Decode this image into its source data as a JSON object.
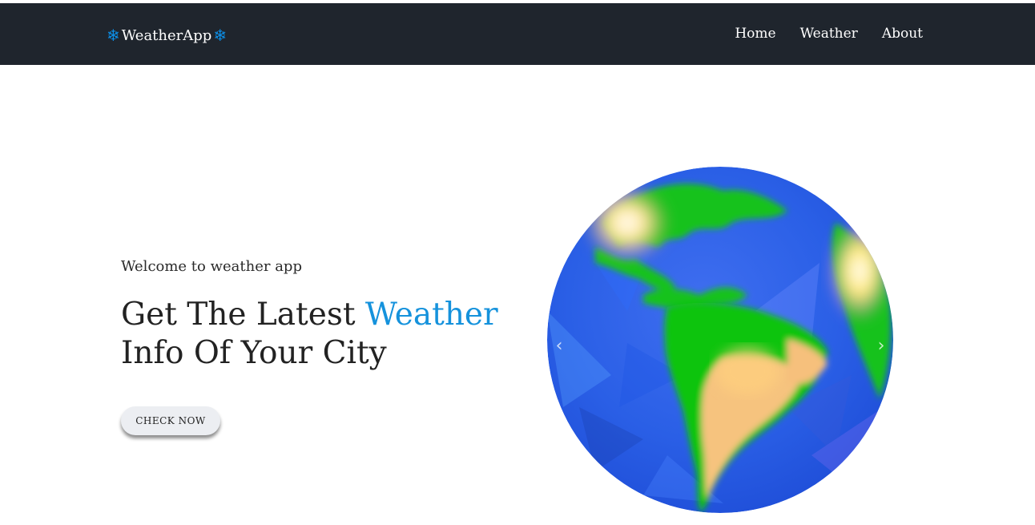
{
  "navbar": {
    "brand": "WeatherApp",
    "brand_icon": "snowflake-icon",
    "brand_icon_glyph": "❄",
    "links": [
      "Home",
      "Weather",
      "About"
    ]
  },
  "hero": {
    "welcome": "Welcome to weather app",
    "headline_part1": "Get The Latest ",
    "headline_accent": "Weather",
    "headline_part2": "Info Of Your City",
    "cta_label": "CHECK NOW"
  },
  "carousel": {
    "image": "earth-globe-lowpoly-image",
    "prev_icon": "chevron-left-icon",
    "next_icon": "chevron-right-icon",
    "prev_glyph": "‹",
    "next_glyph": "›"
  },
  "colors": {
    "navbar_bg": "#1f252d",
    "accent": "#1592dc",
    "snowflake": "#0c8ee6"
  }
}
